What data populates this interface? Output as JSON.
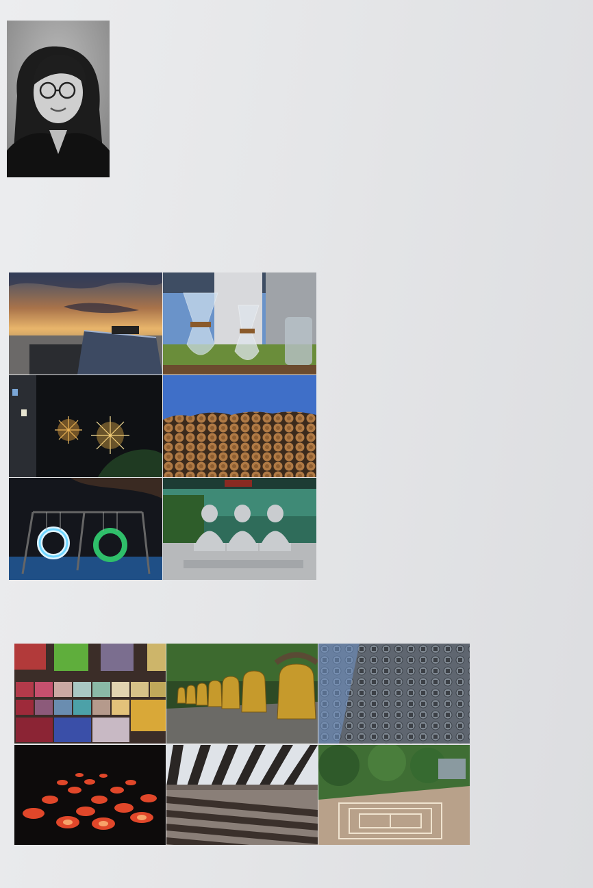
{
  "page": {
    "background": "#e6e7e9"
  },
  "photos": {
    "portrait": {
      "subject": "portrait",
      "style": "black-and-white"
    },
    "grid_top": [
      {
        "subject": "sunset-over-sea-with-pier"
      },
      {
        "subject": "glass-coffee-drippers-on-windowsill"
      },
      {
        "subject": "fireworks-at-night"
      },
      {
        "subject": "stacked-logs-under-blue-sky"
      },
      {
        "subject": "glowing-ring-swings-at-night"
      },
      {
        "subject": "three-stone-monk-statues"
      }
    ],
    "grid_bottom": [
      {
        "subject": "colored-fabric-swatches"
      },
      {
        "subject": "row-of-golden-bells"
      },
      {
        "subject": "patterned-wall-against-sky"
      },
      {
        "subject": "glowing-orange-floor-lights"
      },
      {
        "subject": "slatted-roof-shadows"
      },
      {
        "subject": "maze-garden-from-above"
      }
    ]
  }
}
